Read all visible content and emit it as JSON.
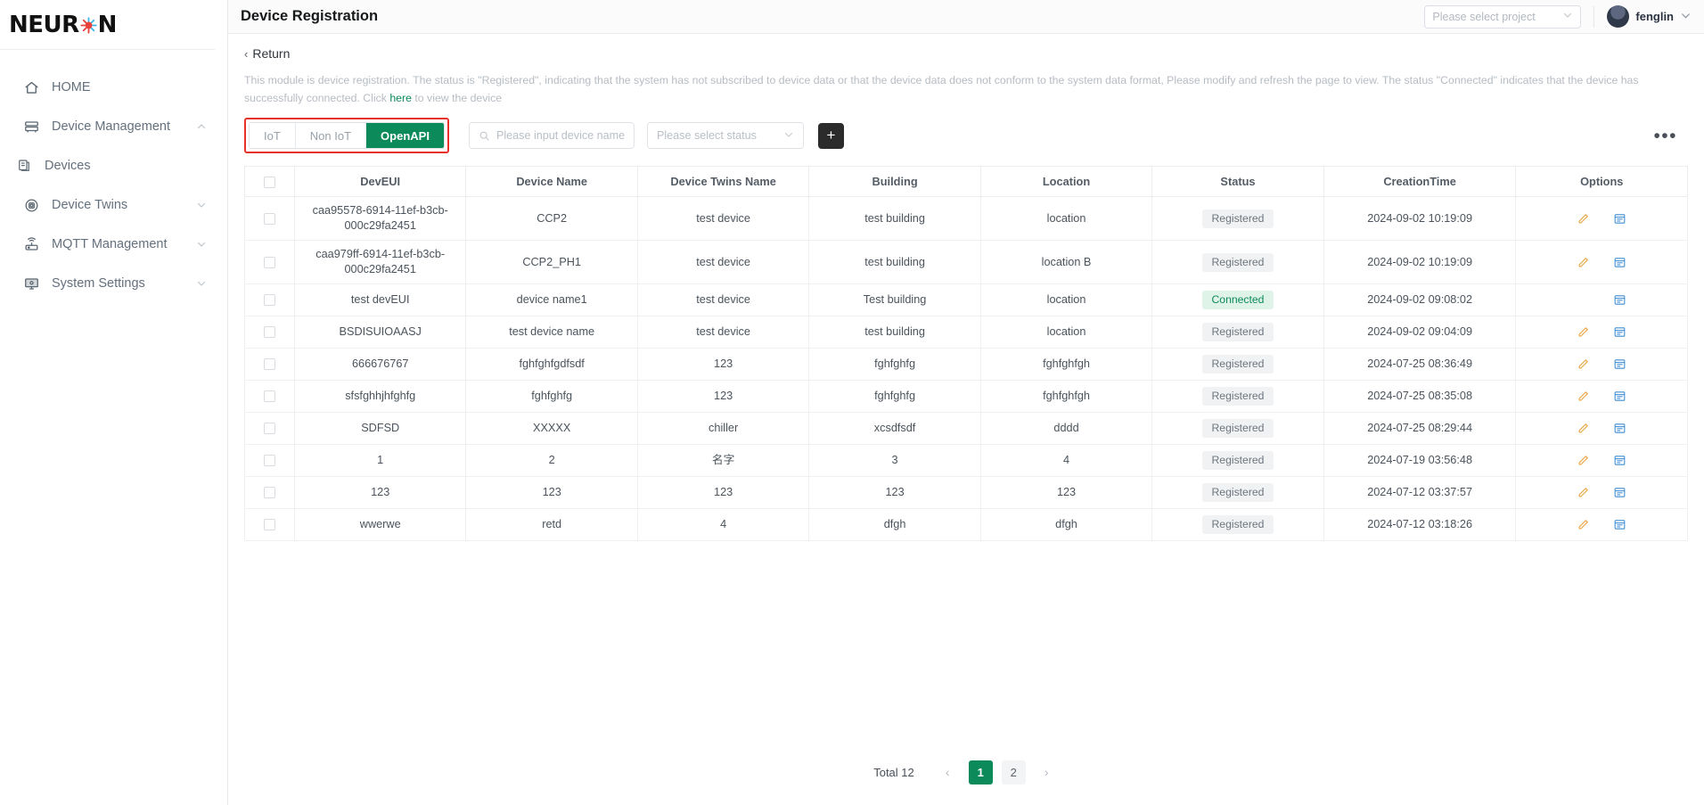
{
  "brand": {
    "name": "NEUR",
    "name_tail": "N",
    "star_icon": "asterisk-star-icon"
  },
  "sidebar": {
    "items": [
      {
        "label": "HOME",
        "icon": "home-icon",
        "chevron": "",
        "sub": false
      },
      {
        "label": "Device Management",
        "icon": "server-icon",
        "chevron": "⌃",
        "sub": false
      },
      {
        "label": "Devices",
        "icon": "device-list-icon",
        "chevron": "",
        "sub": true
      },
      {
        "label": "Device Twins",
        "icon": "twins-circle-icon",
        "chevron": "⌄",
        "sub": false
      },
      {
        "label": "MQTT Management",
        "icon": "router-icon",
        "chevron": "⌄",
        "sub": false
      },
      {
        "label": "System Settings",
        "icon": "monitor-icon",
        "chevron": "⌄",
        "sub": false
      }
    ]
  },
  "header": {
    "title": "Device Registration",
    "project_placeholder": "Please select project",
    "user_name": "fenglin",
    "avatar_icon": "avatar",
    "chevron_icon": "chevron-down-icon"
  },
  "page": {
    "return_label": "Return",
    "back_icon": "chevron-left-icon",
    "description_part1": "This module is device registration. The status is \"Registered\", indicating that the system has not subscribed to device data or that the device data does not conform to the system data format, Please modify and refresh the page to view. The status \"Connected\" indicates that the device has successfully connected. Click ",
    "description_link": "here",
    "description_part2": " to view the device"
  },
  "toolbar": {
    "tabs": [
      {
        "label": "IoT",
        "active": false
      },
      {
        "label": "Non IoT",
        "active": false
      },
      {
        "label": "OpenAPI",
        "active": true
      }
    ],
    "highlight_color": "#e8312a",
    "accent_color": "#0c8a5a",
    "search_placeholder": "Please input device name",
    "search_value": "",
    "search_icon": "search-icon",
    "status_placeholder": "Please select status",
    "status_chevron": "chevron-down-icon",
    "add_label": "+",
    "more_label": "•••"
  },
  "table": {
    "columns": [
      "",
      "DevEUI",
      "Device Name",
      "Device Twins Name",
      "Building",
      "Location",
      "Status",
      "CreationTime",
      "Options"
    ],
    "rows": [
      {
        "deveui": "caa95578-6914-11ef-b3cb-000c29fa2451",
        "device_name": "CCP2",
        "twins_name": "test device",
        "building": "test building",
        "location": "location",
        "status": "Registered",
        "status_type": "registered",
        "created": "2024-09-02 10:19:09",
        "has_edit": true
      },
      {
        "deveui": "caa979ff-6914-11ef-b3cb-000c29fa2451",
        "device_name": "CCP2_PH1",
        "twins_name": "test device",
        "building": "test building",
        "location": "location B",
        "status": "Registered",
        "status_type": "registered",
        "created": "2024-09-02 10:19:09",
        "has_edit": true
      },
      {
        "deveui": "test devEUI",
        "device_name": "device name1",
        "twins_name": "test device",
        "building": "Test building",
        "location": "location",
        "status": "Connected",
        "status_type": "connected",
        "created": "2024-09-02 09:08:02",
        "has_edit": false
      },
      {
        "deveui": "BSDISUIOAASJ",
        "device_name": "test device name",
        "twins_name": "test device",
        "building": "test building",
        "location": "location",
        "status": "Registered",
        "status_type": "registered",
        "created": "2024-09-02 09:04:09",
        "has_edit": true
      },
      {
        "deveui": "666676767",
        "device_name": "fghfghfgdfsdf",
        "twins_name": "123",
        "building": "fghfghfg",
        "location": "fghfghfgh",
        "status": "Registered",
        "status_type": "registered",
        "created": "2024-07-25 08:36:49",
        "has_edit": true
      },
      {
        "deveui": "sfsfghhjhfghfg",
        "device_name": "fghfghfg",
        "twins_name": "123",
        "building": "fghfghfg",
        "location": "fghfghfgh",
        "status": "Registered",
        "status_type": "registered",
        "created": "2024-07-25 08:35:08",
        "has_edit": true
      },
      {
        "deveui": "SDFSD",
        "device_name": "XXXXX",
        "twins_name": "chiller",
        "building": "xcsdfsdf",
        "location": "dddd",
        "status": "Registered",
        "status_type": "registered",
        "created": "2024-07-25 08:29:44",
        "has_edit": true
      },
      {
        "deveui": "1",
        "device_name": "2",
        "twins_name": "名字",
        "building": "3",
        "location": "4",
        "status": "Registered",
        "status_type": "registered",
        "created": "2024-07-19 03:56:48",
        "has_edit": true
      },
      {
        "deveui": "123",
        "device_name": "123",
        "twins_name": "123",
        "building": "123",
        "location": "123",
        "status": "Registered",
        "status_type": "registered",
        "created": "2024-07-12 03:37:57",
        "has_edit": true
      },
      {
        "deveui": "wwerwe",
        "device_name": "retd",
        "twins_name": "4",
        "building": "dfgh",
        "location": "dfgh",
        "status": "Registered",
        "status_type": "registered",
        "created": "2024-07-12 03:18:26",
        "has_edit": true
      }
    ],
    "edit_icon": "pencil-icon",
    "view_icon": "detail-view-icon"
  },
  "pagination": {
    "total_label": "Total 12",
    "prev_icon": "‹",
    "next_icon": "›",
    "pages": [
      "1",
      "2"
    ],
    "current": "1"
  }
}
